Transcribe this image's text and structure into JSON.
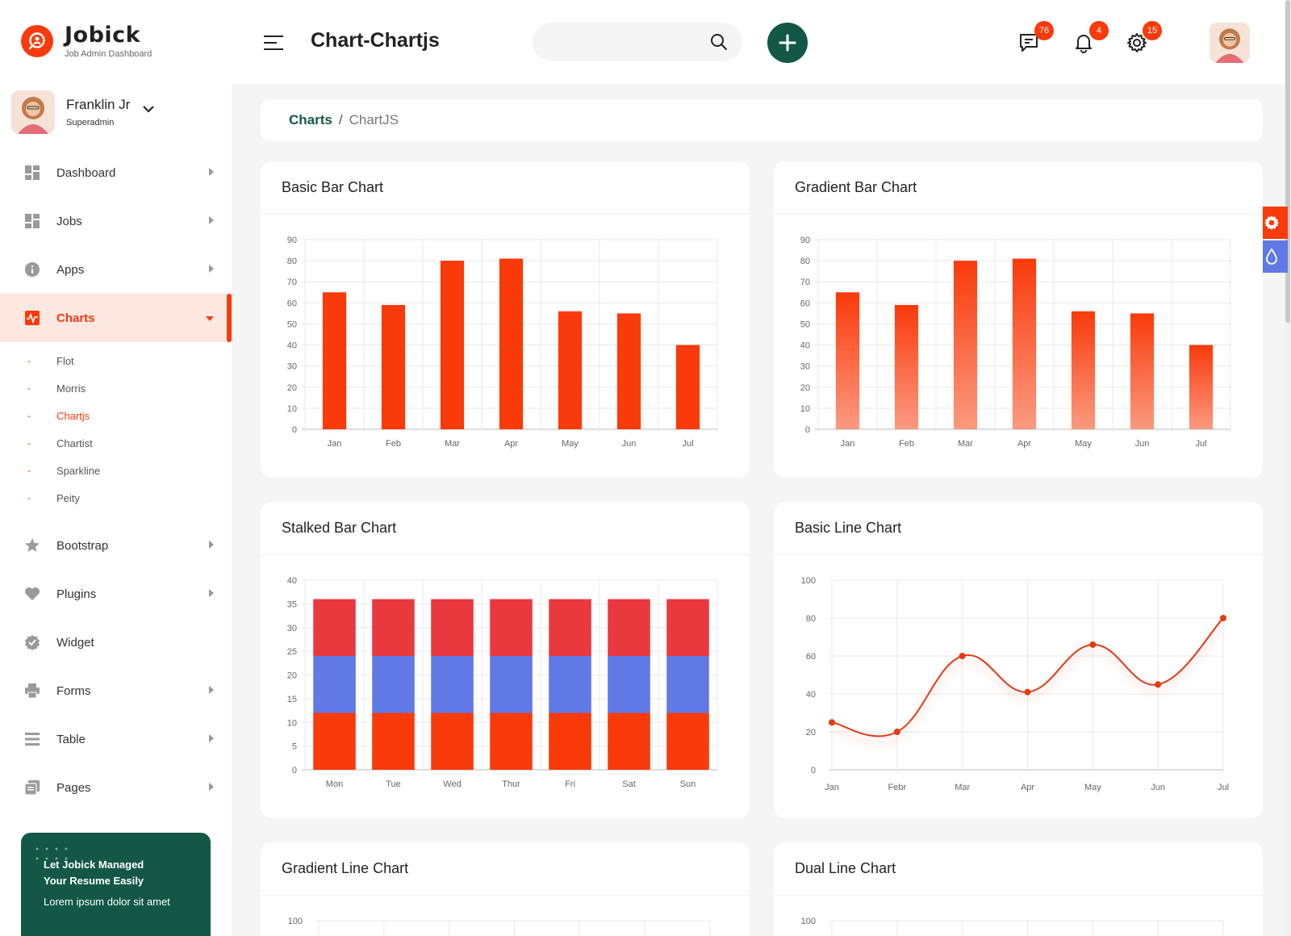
{
  "brand": {
    "name": "Jobick",
    "subtitle": "Job Admin Dashboard"
  },
  "user": {
    "name": "Franklin Jr",
    "role": "Superadmin"
  },
  "menu": {
    "items": [
      {
        "label": "Dashboard",
        "icon": "grid-icon"
      },
      {
        "label": "Jobs",
        "icon": "grid-icon"
      },
      {
        "label": "Apps",
        "icon": "info-icon"
      },
      {
        "label": "Charts",
        "icon": "chart-pulse-icon"
      },
      {
        "label": "Bootstrap",
        "icon": "star-icon"
      },
      {
        "label": "Plugins",
        "icon": "heart-icon"
      },
      {
        "label": "Widget",
        "icon": "badge-check-icon"
      },
      {
        "label": "Forms",
        "icon": "printer-icon"
      },
      {
        "label": "Table",
        "icon": "list-icon"
      },
      {
        "label": "Pages",
        "icon": "pages-icon"
      }
    ],
    "charts_sub": [
      "Flot",
      "Morris",
      "Chartjs",
      "Chartist",
      "Sparkline",
      "Peity"
    ]
  },
  "promo": {
    "title_line1": "Let Jobick Managed",
    "title_line2": "Your Resume Easily",
    "subtitle": "Lorem ipsum dolor sit amet"
  },
  "header": {
    "title": "Chart-Chartjs",
    "search_placeholder": "",
    "badges": {
      "messages": "76",
      "notifications": "4",
      "settings": "15"
    }
  },
  "breadcrumb": {
    "parent": "Charts",
    "separator": "/",
    "current": "ChartJS"
  },
  "colors": {
    "primary": "#f93a0b",
    "dark_green": "#135846",
    "blue": "#6179e5",
    "red": "#e9393f"
  },
  "cards": {
    "basic_bar": "Basic Bar Chart",
    "gradient_bar": "Gradient Bar Chart",
    "stacked_bar": "Stalked Bar Chart",
    "basic_line": "Basic Line Chart",
    "gradient_line": "Gradient Line Chart",
    "dual_line": "Dual Line Chart"
  },
  "chart_data": [
    {
      "id": "basic_bar",
      "type": "bar",
      "title": "Basic Bar Chart",
      "categories": [
        "Jan",
        "Feb",
        "Mar",
        "Apr",
        "May",
        "Jun",
        "Jul"
      ],
      "values": [
        65,
        59,
        80,
        81,
        56,
        55,
        40
      ],
      "ylim": [
        0,
        90
      ],
      "yticks": [
        0,
        10,
        20,
        30,
        40,
        50,
        60,
        70,
        80,
        90
      ],
      "grid": true
    },
    {
      "id": "gradient_bar",
      "type": "bar",
      "title": "Gradient Bar Chart",
      "categories": [
        "Jan",
        "Feb",
        "Mar",
        "Apr",
        "May",
        "Jun",
        "Jul"
      ],
      "values": [
        65,
        59,
        80,
        81,
        56,
        55,
        40
      ],
      "ylim": [
        0,
        90
      ],
      "yticks": [
        0,
        10,
        20,
        30,
        40,
        50,
        60,
        70,
        80,
        90
      ],
      "grid": true
    },
    {
      "id": "stacked_bar",
      "type": "bar",
      "stacked": true,
      "title": "Stalked Bar Chart",
      "categories": [
        "Mon",
        "Tue",
        "Wed",
        "Thur",
        "Fri",
        "Sat",
        "Sun"
      ],
      "series": [
        {
          "values": [
            12,
            12,
            12,
            12,
            12,
            12,
            12
          ],
          "color": "#f93a0b"
        },
        {
          "values": [
            12,
            12,
            12,
            12,
            12,
            12,
            12
          ],
          "color": "#6179e5"
        },
        {
          "values": [
            12,
            12,
            12,
            12,
            12,
            12,
            12
          ],
          "color": "#e9393f"
        }
      ],
      "ylim": [
        0,
        40
      ],
      "yticks": [
        0,
        5,
        10,
        15,
        20,
        25,
        30,
        35,
        40
      ],
      "grid": true
    },
    {
      "id": "basic_line",
      "type": "line",
      "title": "Basic Line Chart",
      "categories": [
        "Jan",
        "Febr",
        "Mar",
        "Apr",
        "May",
        "Jun",
        "Jul"
      ],
      "values": [
        25,
        20,
        60,
        41,
        66,
        45,
        80
      ],
      "ylim": [
        0,
        100
      ],
      "yticks": [
        0,
        20,
        40,
        60,
        80,
        100
      ],
      "grid": true
    },
    {
      "id": "gradient_line",
      "type": "line",
      "title": "Gradient Line Chart",
      "yticks_visible": [
        "100"
      ]
    },
    {
      "id": "dual_line",
      "type": "line",
      "title": "Dual Line Chart",
      "yticks_visible": [
        "100"
      ]
    }
  ]
}
